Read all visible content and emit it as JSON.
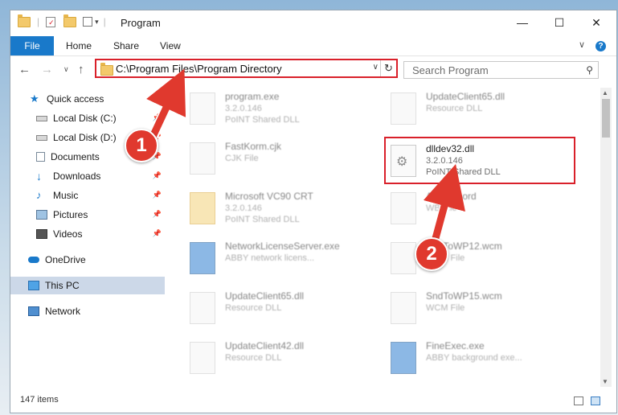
{
  "window": {
    "title": "Program",
    "controls": {
      "minimize": "—",
      "maximize": "☐",
      "close": "✕"
    }
  },
  "ribbon": {
    "tabs": [
      "File",
      "Home",
      "Share",
      "View"
    ],
    "collapse_glyph": "∨",
    "help_glyph": "?"
  },
  "address": {
    "path": "C:\\Program Files\\Program Directory",
    "dropdown_glyph": "∨",
    "refresh_glyph": "↻"
  },
  "search": {
    "placeholder": "Search Program"
  },
  "nav": {
    "back": "←",
    "forward": "→",
    "recent": "∨",
    "up": "↑"
  },
  "sidebar": {
    "items": [
      {
        "label": "Quick access",
        "pinned": false
      },
      {
        "label": "Local Disk (C:)",
        "pinned": true
      },
      {
        "label": "Local Disk (D:)",
        "pinned": true
      },
      {
        "label": "Documents",
        "pinned": true
      },
      {
        "label": "Downloads",
        "pinned": true
      },
      {
        "label": "Music",
        "pinned": true
      },
      {
        "label": "Pictures",
        "pinned": true
      },
      {
        "label": "Videos",
        "pinned": true
      },
      {
        "label": "OneDrive",
        "pinned": false
      },
      {
        "label": "This PC",
        "pinned": false,
        "selected": true
      },
      {
        "label": "Network",
        "pinned": false
      }
    ]
  },
  "files": [
    {
      "name": "program.exe",
      "line2": "3.2.0.146",
      "line3": "PoINT Shared DLL"
    },
    {
      "name": "UpdateClient65.dll",
      "line2": "Resource DLL",
      "line3": ""
    },
    {
      "name": "FastKorm.cjk",
      "line2": "CJK File",
      "line3": ""
    },
    {
      "name": "dlldev32.dll",
      "line2": "3.2.0.146",
      "line3": "PoINT Shared DLL"
    },
    {
      "name": "Microsoft VC90 CRT",
      "line2": "3.2.0.146",
      "line3": "PoINT Shared DLL"
    },
    {
      "name": "AutoSpl.ord",
      "line2": "WB File",
      "line3": ""
    },
    {
      "name": "NetworkLicenseServer.exe",
      "line2": "ABBY network licens...",
      "line3": ""
    },
    {
      "name": "SndToWP12.wcm",
      "line2": "WCM File",
      "line3": ""
    },
    {
      "name": "UpdateClient65.dll",
      "line2": "Resource DLL",
      "line3": ""
    },
    {
      "name": "SndToWP15.wcm",
      "line2": "WCM File",
      "line3": ""
    },
    {
      "name": "UpdateClient42.dll",
      "line2": "Resource DLL",
      "line3": ""
    },
    {
      "name": "FineExec.exe",
      "line2": "ABBY background exe...",
      "line3": ""
    }
  ],
  "status": {
    "item_count": "147 items"
  },
  "callouts": [
    "1",
    "2"
  ],
  "colors": {
    "accent": "#1979ca",
    "highlight": "#d9202a",
    "callout": "#e0392e"
  }
}
